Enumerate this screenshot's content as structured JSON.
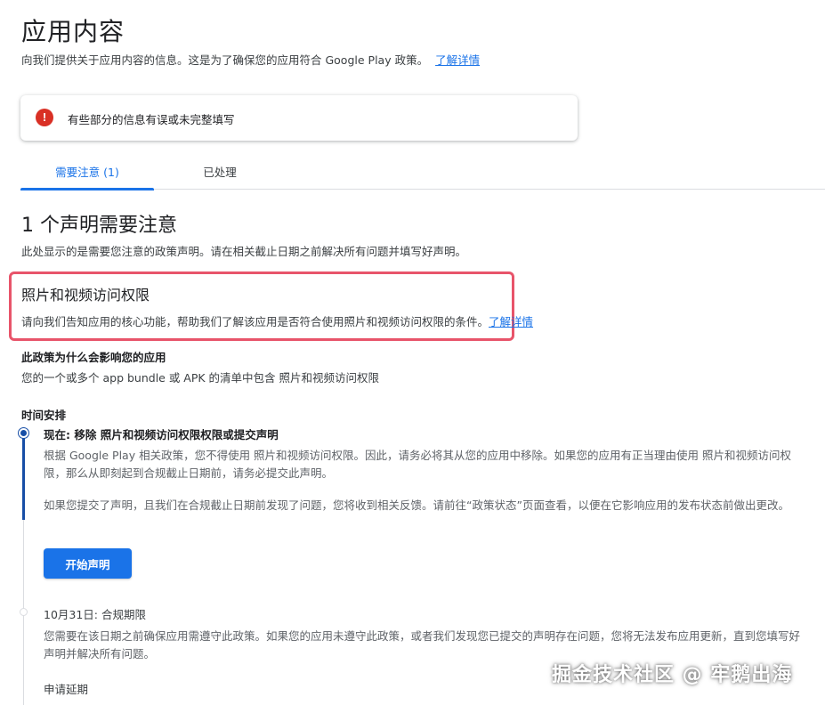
{
  "header": {
    "title": "应用内容",
    "subtitle": "向我们提供关于应用内容的信息。这是为了确保您的应用符合 Google Play 政策。",
    "learn_more": "了解详情"
  },
  "alert": {
    "icon": "error-icon",
    "icon_glyph": "!",
    "color": "#d93025",
    "text": "有些部分的信息有误或未完整填写"
  },
  "tabs": [
    {
      "label": "需要注意 (1)",
      "selected": true
    },
    {
      "label": "已处理",
      "selected": false
    }
  ],
  "section": {
    "title": "1 个声明需要注意",
    "description": "此处显示的是需要您注意的政策声明。请在相关截止日期之前解决所有问题并填写好声明。"
  },
  "policy": {
    "title": "照片和视频访问权限",
    "description": "请向我们告知应用的核心功能，帮助我们了解该应用是否符合使用照片和视频访问权限的条件。",
    "learn_more": "了解详情",
    "highlight_color": "#e8546a"
  },
  "why": {
    "title": "此政策为什么会影响您的应用",
    "description": "您的一个或多个 app bundle 或 APK 的清单中包含 照片和视频访问权限"
  },
  "timeline": {
    "title": "时间安排",
    "step1": {
      "title": "现在: 移除 照片和视频访问权限权限或提交声明",
      "para1": "根据 Google Play 相关政策，您不得使用 照片和视频访问权限。因此，请务必将其从您的应用中移除。如果您的应用有正当理由使用 照片和视频访问权限，那么从即刻起到合规截止日期前，请务必提交此声明。",
      "para2": "如果您提交了声明，且我们在合规截止日期前发现了问题，您将收到相关反馈。请前往“政策状态”页面查看，以便在它影响应用的发布状态前做出更改。",
      "button": "开始声明"
    },
    "step2": {
      "title": "10月31日: 合规期限",
      "para": "您需要在该日期之前确保应用需遵守此政策。如果您的应用未遵守此政策，或者我们发现您已提交的声明存在问题，您将无法发布应用更新，直到您填写好声明并解决所有问题。"
    },
    "extend": "申请延期"
  },
  "watermark": "掘金技术社区 @ 牢鹅出海",
  "colors": {
    "accent": "#1a73e8",
    "timeline_active": "#174ea6"
  }
}
